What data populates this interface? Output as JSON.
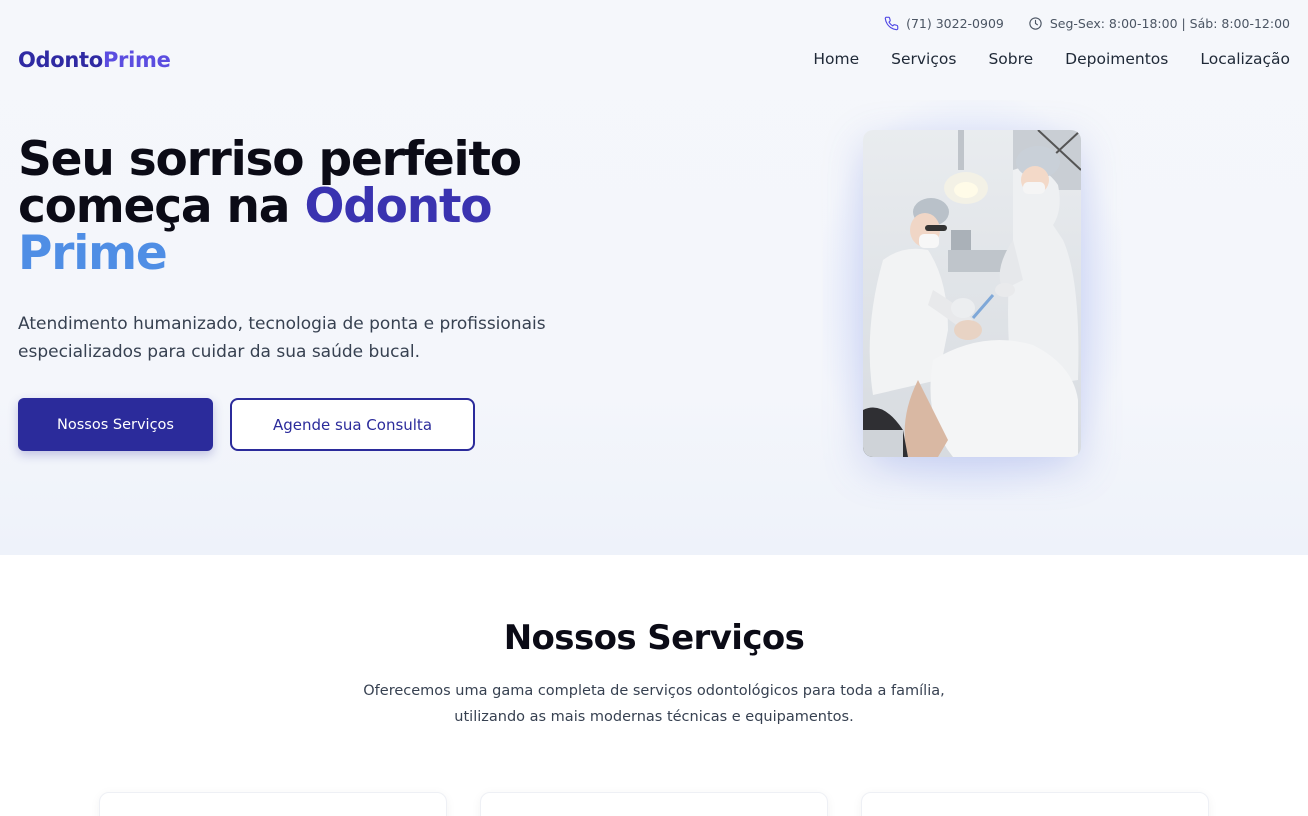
{
  "topbar": {
    "phone": "(71) 3022-0909",
    "hours": "Seg-Sex: 8:00-18:00 | Sáb: 8:00-12:00",
    "phone_icon": "phone-icon",
    "clock_icon": "clock-icon"
  },
  "brand": {
    "part1": "Odonto",
    "part2": "Prime"
  },
  "nav": {
    "items": [
      "Home",
      "Serviços",
      "Sobre",
      "Depoimentos",
      "Localização"
    ]
  },
  "hero": {
    "title_line1": "Seu sorriso perfeito",
    "title_line2_prefix": "começa na ",
    "title_highlight1": "Odonto",
    "title_highlight2": "Prime",
    "subtitle": "Atendimento humanizado, tecnologia de ponta e profissionais especializados para cuidar da sua saúde bucal.",
    "primary_button": "Nossos Serviços",
    "secondary_button": "Agende sua Consulta"
  },
  "services": {
    "title": "Nossos Serviços",
    "subtitle_line1": "Oferecemos uma gama completa de serviços odontológicos para toda a família,",
    "subtitle_line2": "utilizando as mais modernas técnicas e equipamentos."
  },
  "colors": {
    "brand_dark": "#2f2aa3",
    "brand_light": "#5b4de0",
    "accent_blue": "#4f8ee5",
    "button": "#2b2b9b"
  }
}
